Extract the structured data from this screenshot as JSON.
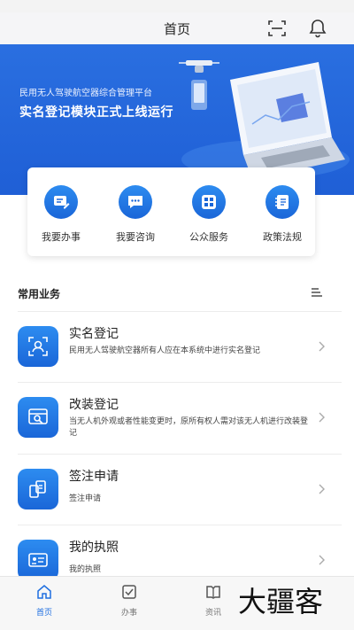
{
  "header": {
    "title": "首页"
  },
  "banner": {
    "subtitle": "民用无人驾驶航空器综合管理平台",
    "headline": "实名登记模块正式上线运行"
  },
  "quick_actions": [
    {
      "label": "我要办事",
      "icon": "edit-document-icon"
    },
    {
      "label": "我要咨询",
      "icon": "chat-bubble-icon"
    },
    {
      "label": "公众服务",
      "icon": "grid-apps-icon"
    },
    {
      "label": "政策法规",
      "icon": "notebook-icon"
    }
  ],
  "section": {
    "title": "常用业务"
  },
  "services": [
    {
      "title": "实名登记",
      "desc": "民用无人驾驶航空器所有人应在本系统中进行实名登记",
      "icon": "user-scan-icon"
    },
    {
      "title": "改装登记",
      "desc": "当无人机外观或者性能变更时，原所有权人需对该无人机进行改装登记",
      "icon": "modify-screen-icon"
    },
    {
      "title": "签注申请",
      "desc": "签注申请",
      "icon": "document-stamp-icon"
    },
    {
      "title": "我的执照",
      "desc": "我的执照",
      "icon": "license-card-icon"
    }
  ],
  "tabs": [
    {
      "label": "首页",
      "icon": "home-icon",
      "active": true
    },
    {
      "label": "办事",
      "icon": "checklist-icon",
      "active": false
    },
    {
      "label": "资讯",
      "icon": "book-icon",
      "active": false
    }
  ],
  "watermark": {
    "text": "大疆客"
  },
  "colors": {
    "primary": "#1f6fe0",
    "banner": "#2a6fe0"
  }
}
